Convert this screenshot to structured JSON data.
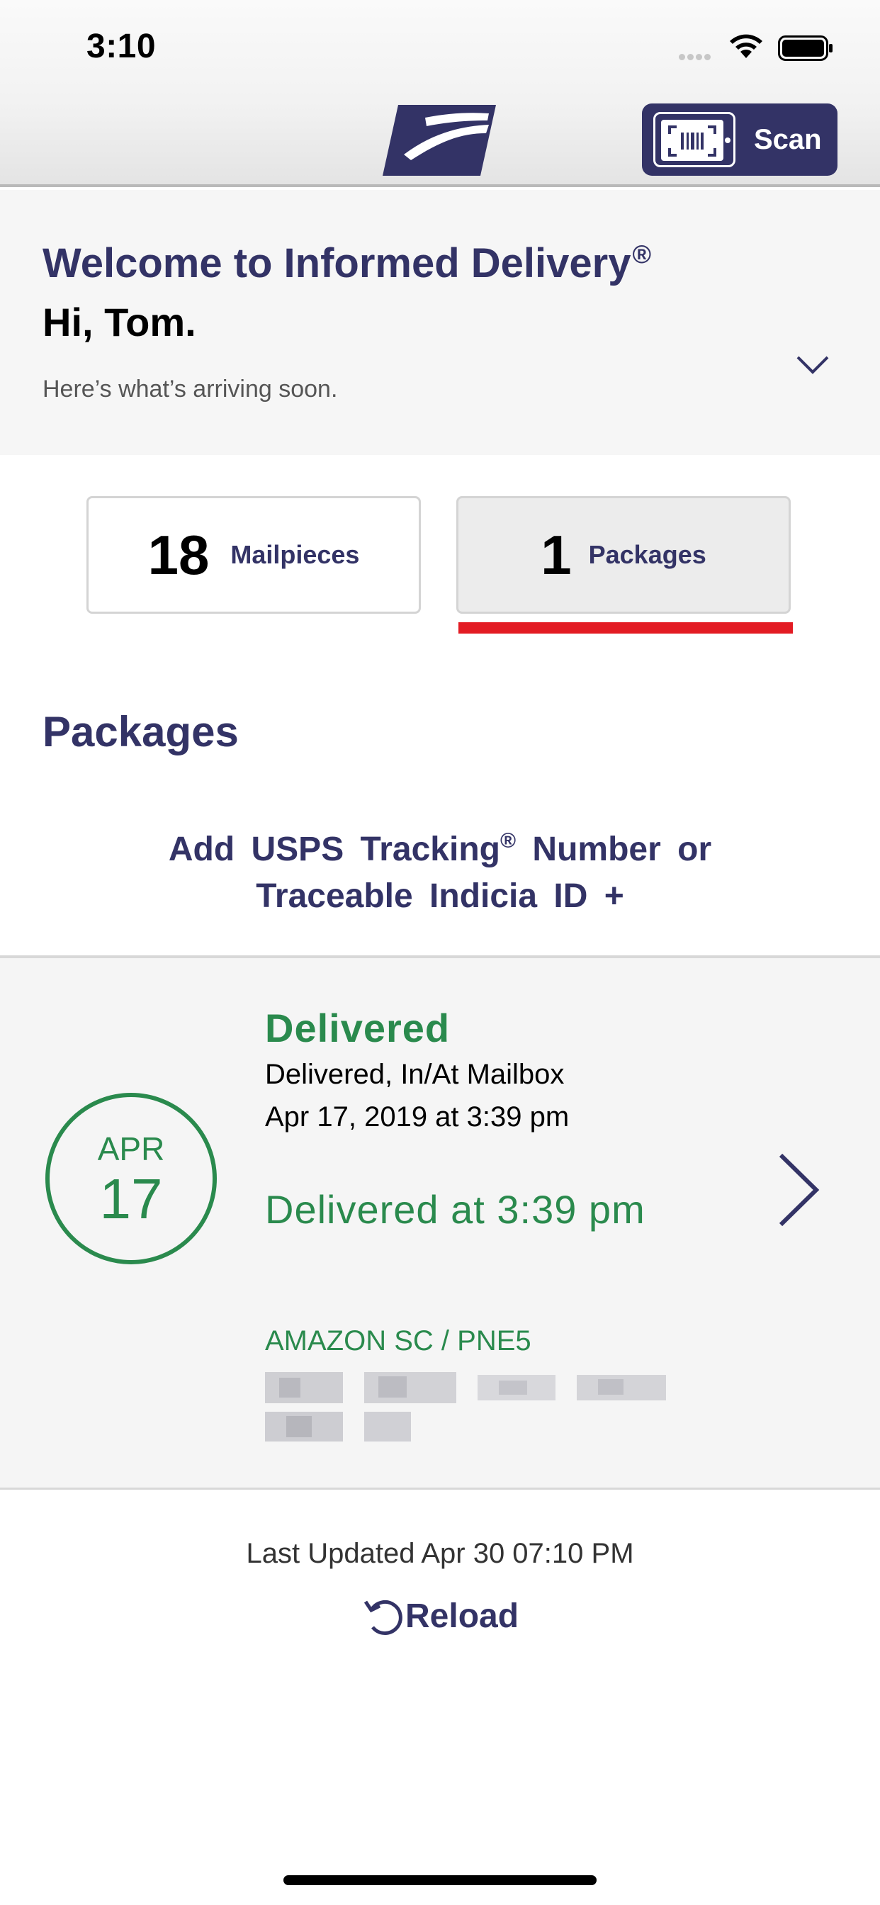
{
  "status_bar": {
    "time": "3:10"
  },
  "nav": {
    "logo_icon": "usps-eagle-icon",
    "scan_label": "Scan",
    "scan_icon": "barcode-scanner-icon"
  },
  "colors": {
    "navy": "#333366",
    "green": "#2a8a4d",
    "red": "#e31b23"
  },
  "welcome": {
    "title": "Welcome to Informed Delivery",
    "title_mark": "®",
    "greeting": "Hi, Tom.",
    "subtitle": "Here’s what’s arriving soon."
  },
  "tabs": [
    {
      "count": "18",
      "label": "Mailpieces",
      "selected": false
    },
    {
      "count": "1",
      "label": "Packages",
      "selected": true
    }
  ],
  "packages": {
    "heading": "Packages",
    "add_tracking_part1": "Add USPS Tracking",
    "add_tracking_mark": "®",
    "add_tracking_part2": "Number or",
    "add_tracking_line2": "Traceable Indicia ID +"
  },
  "package_card": {
    "month": "APR",
    "day": "17",
    "status": "Delivered",
    "status_detail": "Delivered, In/At Mailbox",
    "status_date": "Apr 17, 2019 at 3:39 pm",
    "delivered_time": "Delivered at 3:39 pm",
    "shipper": "AMAZON SC / PNE5"
  },
  "footer": {
    "last_updated": "Last Updated Apr 30 07:10 PM",
    "reload_label": "Reload"
  }
}
